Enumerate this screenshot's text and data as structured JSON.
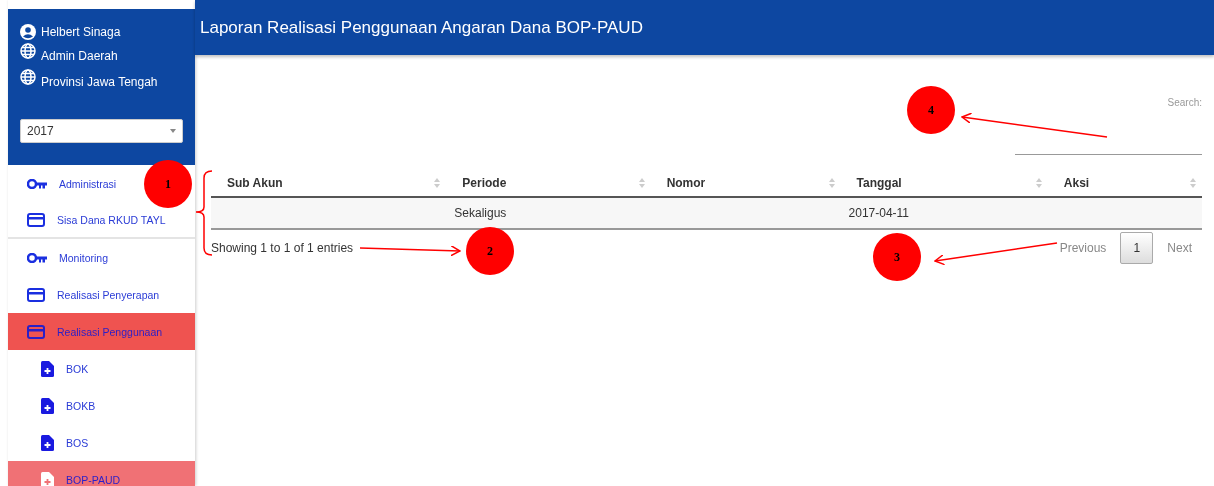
{
  "header": {
    "title": "Laporan Realisasi Penggunaan Angaran Dana BOP-PAUD"
  },
  "profile": [
    {
      "kind": "user",
      "text": "Helbert Sinaga"
    },
    {
      "kind": "globe",
      "text": "Admin Daerah"
    },
    {
      "kind": "globe",
      "text": "Provinsi Jawa Tengah"
    }
  ],
  "year_select": {
    "value": "2017"
  },
  "sidebar": {
    "items": [
      {
        "kind": "key",
        "label": "Administrasi",
        "selected": false,
        "divider": false
      },
      {
        "kind": "card",
        "label": "Sisa Dana RKUD TAYL",
        "selected": false,
        "divider": true
      },
      {
        "kind": "key",
        "label": "Monitoring",
        "selected": false,
        "divider": false
      },
      {
        "kind": "card",
        "label": "Realisasi Penyerapan",
        "selected": false,
        "divider": false
      },
      {
        "kind": "card",
        "label": "Realisasi Penggunaan",
        "selected": true,
        "divider": false,
        "children": [
          {
            "kind": "file",
            "label": "BOK",
            "selected": false
          },
          {
            "kind": "file",
            "label": "BOKB",
            "selected": false
          },
          {
            "kind": "file",
            "label": "BOS",
            "selected": false
          },
          {
            "kind": "file",
            "label": "BOP-PAUD",
            "selected": true
          }
        ]
      }
    ]
  },
  "search": {
    "label": "Search:"
  },
  "table": {
    "columns": [
      "Sub Akun",
      "Periode",
      "Nomor",
      "Tanggal",
      "Aksi"
    ],
    "rows": [
      {
        "cells": [
          null,
          "Sekaligus",
          null,
          "2017-04-11",
          null
        ]
      }
    ]
  },
  "info": "Showing 1 to 1 of 1 entries",
  "pagination": {
    "previous": "Previous",
    "pages": [
      {
        "label": "1",
        "selected": true
      }
    ],
    "next": "Next"
  },
  "annotations": [
    {
      "number": "1"
    },
    {
      "number": "2"
    },
    {
      "number": "3"
    },
    {
      "number": "4"
    }
  ]
}
